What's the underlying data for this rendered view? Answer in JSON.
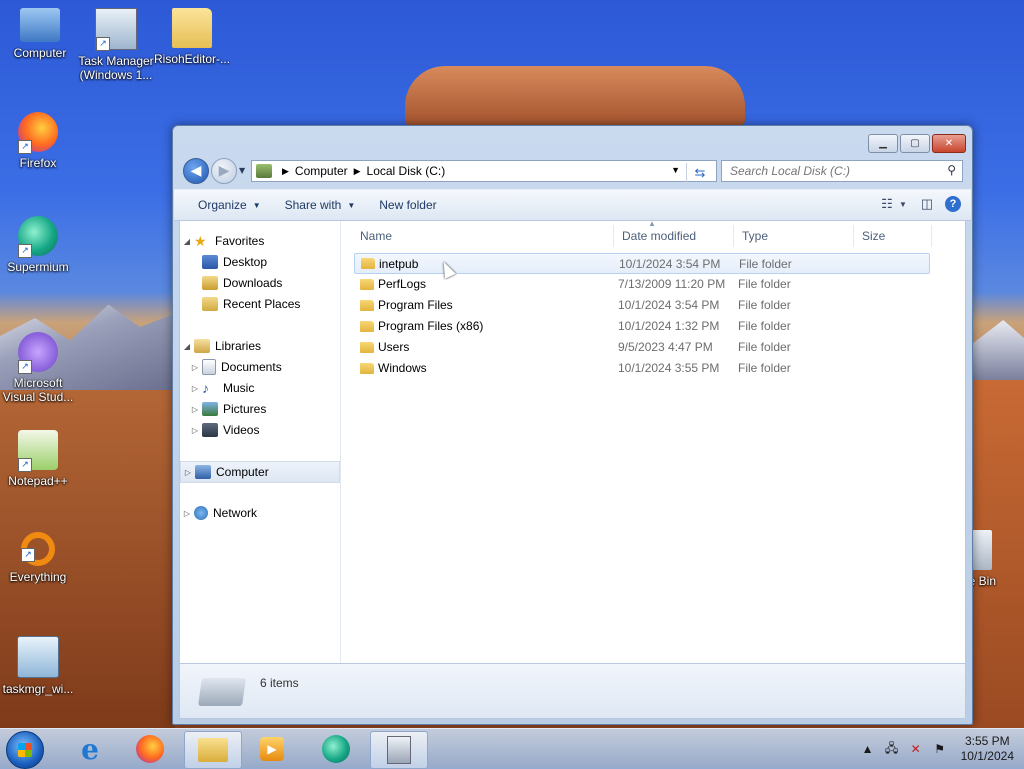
{
  "desktop": {
    "icons": [
      {
        "label": "Computer"
      },
      {
        "label": "Task Manager (Windows 1..."
      },
      {
        "label": "RisohEditor-..."
      },
      {
        "label": "Firefox"
      },
      {
        "label": "Supermium"
      },
      {
        "label": "Microsoft Visual Stud..."
      },
      {
        "label": "Notepad++"
      },
      {
        "label": "Everything"
      },
      {
        "label": "taskmgr_wi..."
      },
      {
        "label": "le Bin"
      }
    ]
  },
  "window": {
    "address": {
      "root": "Computer",
      "current": "Local Disk (C:)"
    },
    "search": {
      "placeholder": "Search Local Disk (C:)"
    },
    "toolbar": {
      "organize": "Organize",
      "share_with": "Share with",
      "new_folder": "New folder"
    },
    "nav": {
      "favorites": "Favorites",
      "desktop": "Desktop",
      "downloads": "Downloads",
      "recent": "Recent Places",
      "libraries": "Libraries",
      "documents": "Documents",
      "music": "Music",
      "pictures": "Pictures",
      "videos": "Videos",
      "computer": "Computer",
      "network": "Network"
    },
    "columns": {
      "name": "Name",
      "date": "Date modified",
      "type": "Type",
      "size": "Size"
    },
    "files": [
      {
        "name": "inetpub",
        "date": "10/1/2024 3:54 PM",
        "type": "File folder"
      },
      {
        "name": "PerfLogs",
        "date": "7/13/2009 11:20 PM",
        "type": "File folder"
      },
      {
        "name": "Program Files",
        "date": "10/1/2024 3:54 PM",
        "type": "File folder"
      },
      {
        "name": "Program Files (x86)",
        "date": "10/1/2024 1:32 PM",
        "type": "File folder"
      },
      {
        "name": "Users",
        "date": "9/5/2023 4:47 PM",
        "type": "File folder"
      },
      {
        "name": "Windows",
        "date": "10/1/2024 3:55 PM",
        "type": "File folder"
      }
    ],
    "details": {
      "count": "6 items"
    }
  },
  "taskbar": {
    "time": "3:55 PM",
    "date": "10/1/2024"
  }
}
